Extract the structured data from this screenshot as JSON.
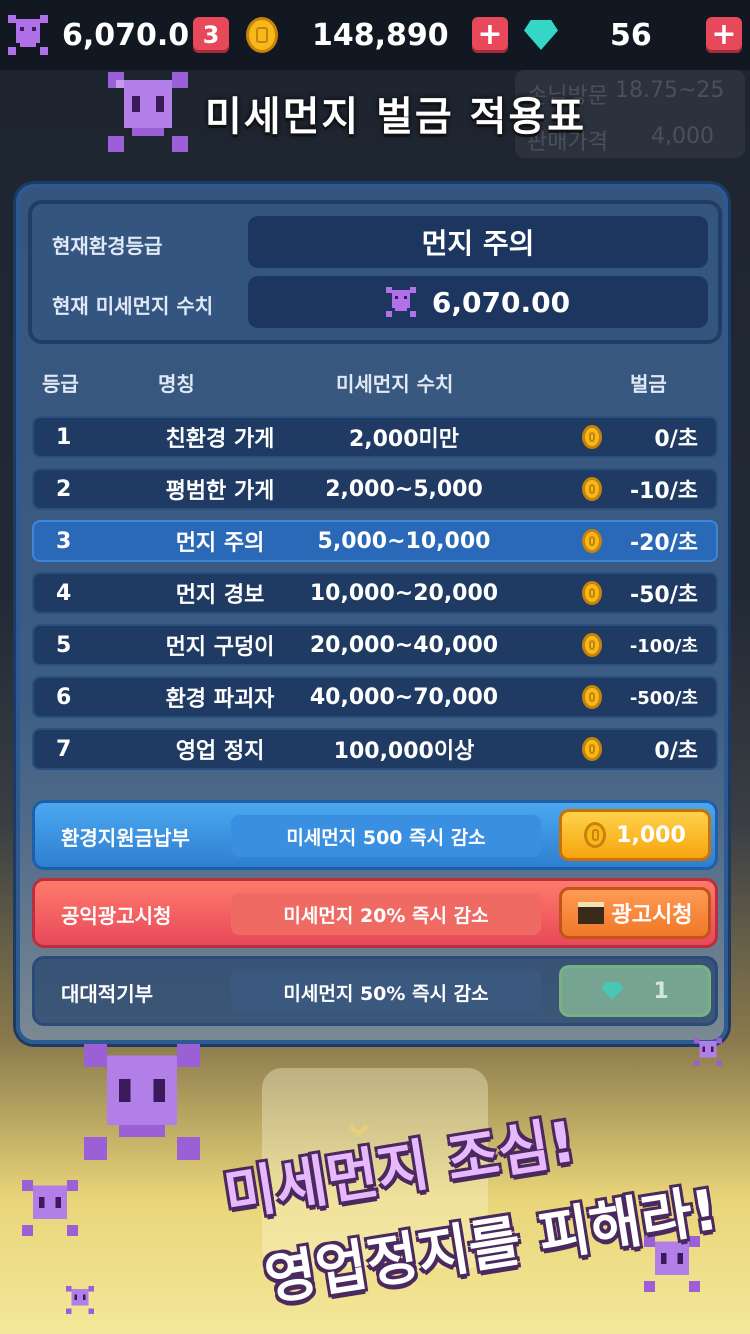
{
  "topbar": {
    "dust_value": "6,070.0",
    "dust_badge": "3",
    "coins": "148,890",
    "gems": "56",
    "plus": "+"
  },
  "background": {
    "line1_label": "손님방문",
    "line1_value": "18.75~25",
    "line2_label": "판매가격",
    "line2_value": "4,000"
  },
  "title": "미세먼지 벌금 적용표",
  "status": {
    "grade_label": "현재환경등급",
    "grade_value": "먼지 주의",
    "dust_label": "현재 미세먼지 수치",
    "dust_value": "6,070.00"
  },
  "table": {
    "headers": [
      "등급",
      "명칭",
      "미세먼지 수치",
      "벌금"
    ],
    "rows": [
      {
        "grade": "1",
        "name": "친환경 가게",
        "range": "2,000미만",
        "fine": "0/초"
      },
      {
        "grade": "2",
        "name": "평범한 가게",
        "range": "2,000~5,000",
        "fine": "-10/초"
      },
      {
        "grade": "3",
        "name": "먼지 주의",
        "range": "5,000~10,000",
        "fine": "-20/초"
      },
      {
        "grade": "4",
        "name": "먼지 경보",
        "range": "10,000~20,000",
        "fine": "-50/초"
      },
      {
        "grade": "5",
        "name": "먼지 구덩이",
        "range": "20,000~40,000",
        "fine": "-100/초"
      },
      {
        "grade": "6",
        "name": "환경 파괴자",
        "range": "40,000~70,000",
        "fine": "-500/초"
      },
      {
        "grade": "7",
        "name": "영업 정지",
        "range": "100,000이상",
        "fine": "0/초"
      }
    ],
    "highlighted_row": 3
  },
  "actions": [
    {
      "label": "환경지원금납부",
      "desc": "미세먼지 500 즉시 감소",
      "button": "1,000",
      "button_icon": "coin-icon"
    },
    {
      "label": "공익광고시청",
      "desc": "미세먼지 20% 즉시 감소",
      "button": "광고시청",
      "button_icon": "clapperboard-icon"
    },
    {
      "label": "대대적기부",
      "desc": "미세먼지 50% 즉시 감소",
      "button": "1",
      "button_icon": "gem-icon"
    }
  ],
  "slogan": {
    "line1": "미세먼지 조심!",
    "line2": "영업정지를 피해라!"
  },
  "colors": {
    "accent_red": "#e8495a",
    "coin_gold": "#f6b91a",
    "gem_teal": "#34d6c5",
    "skull_purple": "#9b5fd6",
    "highlight_blue": "#2a68b8"
  }
}
